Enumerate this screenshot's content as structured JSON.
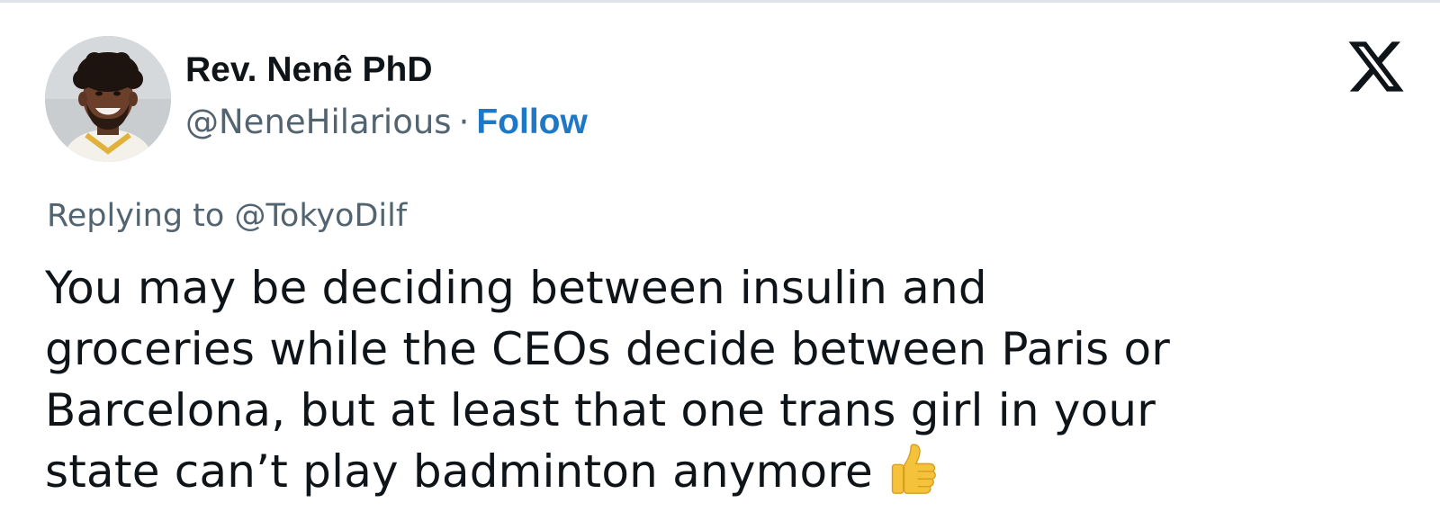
{
  "tweet": {
    "author_name": "Rev. Nenê PhD",
    "author_handle": "@NeneHilarious",
    "separator": "·",
    "follow_label": "Follow",
    "replying_prefix": "Replying to",
    "replying_to": "@TokyoDilf",
    "text_lines": [
      "You may be deciding between insulin and",
      "groceries while the CEOs decide between Paris or",
      "Barcelona, but at least that one trans girl in your",
      "state can’t play badminton anymore"
    ],
    "trailing_emoji": "thumbs-up-icon",
    "platform_logo": "x-logo-icon"
  },
  "colors": {
    "text_primary": "#0f1419",
    "text_secondary": "#536471",
    "follow_blue": "#1d79c7",
    "background": "#ffffff"
  }
}
